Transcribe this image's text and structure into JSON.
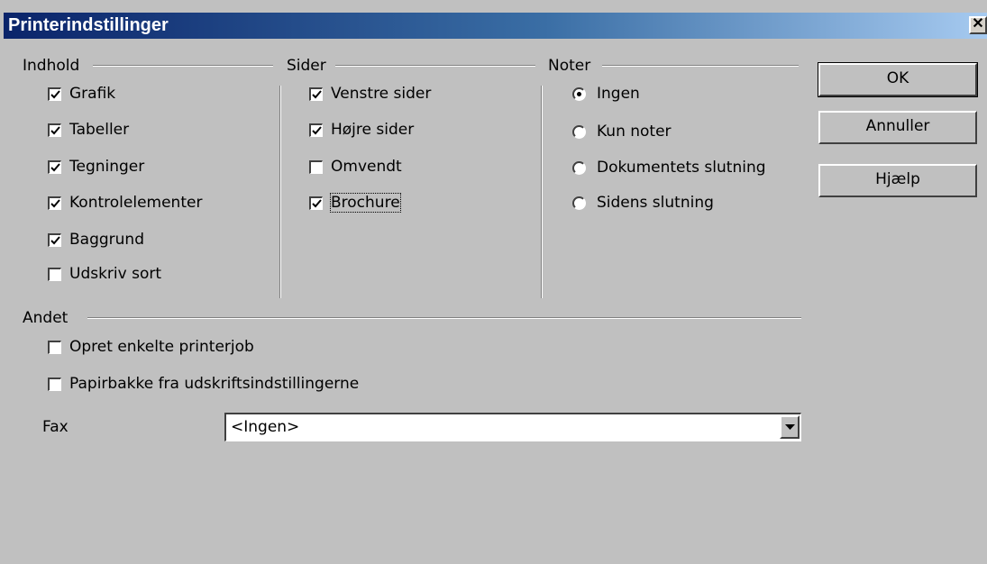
{
  "window": {
    "title": "Printerindstillinger",
    "close_glyph": "✕"
  },
  "groups": {
    "indhold": {
      "label": "Indhold",
      "items": [
        {
          "label": "Grafik",
          "checked": true
        },
        {
          "label": "Tabeller",
          "checked": true
        },
        {
          "label": "Tegninger",
          "checked": true
        },
        {
          "label": "Kontrolelementer",
          "checked": true
        },
        {
          "label": "Baggrund",
          "checked": true
        },
        {
          "label": "Udskriv sort",
          "checked": false
        }
      ]
    },
    "sider": {
      "label": "Sider",
      "items": [
        {
          "label": "Venstre sider",
          "checked": true
        },
        {
          "label": "Højre sider",
          "checked": true
        },
        {
          "label": "Omvendt",
          "checked": false
        },
        {
          "label": "Brochure",
          "checked": true
        }
      ]
    },
    "noter": {
      "label": "Noter",
      "options": [
        {
          "label": "Ingen",
          "selected": true
        },
        {
          "label": "Kun noter",
          "selected": false
        },
        {
          "label": "Dokumentets slutning",
          "selected": false
        },
        {
          "label": "Sidens slutning",
          "selected": false
        }
      ]
    },
    "andet": {
      "label": "Andet",
      "items": [
        {
          "label": "Opret enkelte printerjob",
          "checked": false
        },
        {
          "label": "Papirbakke fra udskriftsindstillingerne",
          "checked": false
        }
      ]
    }
  },
  "fax": {
    "label": "Fax",
    "value": "<Ingen>"
  },
  "buttons": {
    "ok": "OK",
    "cancel": "Annuller",
    "help": "Hjælp"
  },
  "colors": {
    "dialog_bg": "#c0c0c0",
    "titlebar_start": "#0a246a",
    "titlebar_end": "#a6caf0"
  }
}
